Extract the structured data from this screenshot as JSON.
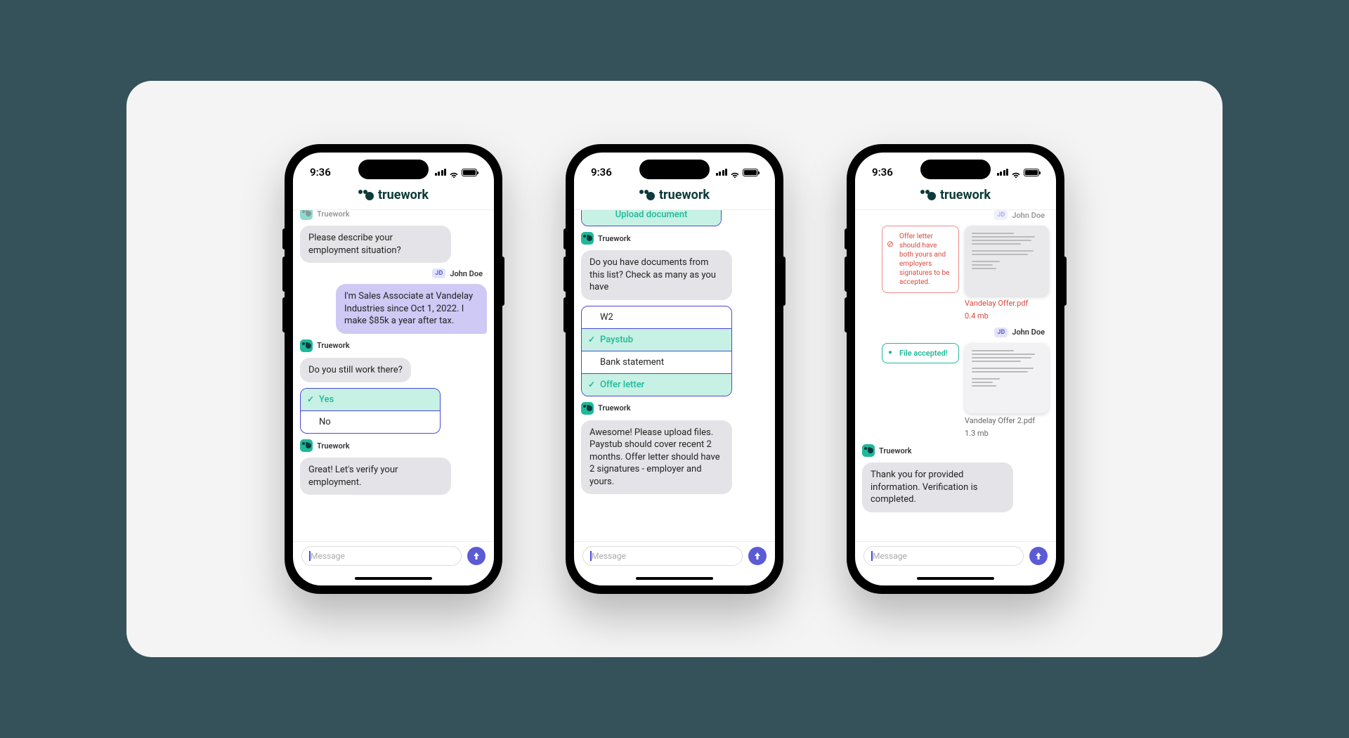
{
  "status": {
    "time": "9:36"
  },
  "brand": "truework",
  "input_placeholder": "Message",
  "phone1": {
    "tw_label": "Truework",
    "user_label": "John Doe",
    "user_initials": "JD",
    "msg1": "Please describe your employment situation?",
    "msg2": "I'm Sales Associate at Vandelay Industries since Oct 1, 2022. I make $85k a year after tax.",
    "msg3": "Do you still work there?",
    "opt_yes": "Yes",
    "opt_no": "No",
    "msg4": "Great! Let's verify your employment."
  },
  "phone2": {
    "tw_label": "Truework",
    "upload_btn": "Upload document",
    "msg1": "Do you have documents from this list? Check as many as you have",
    "opt_w2": "W2",
    "opt_paystub": "Paystub",
    "opt_bank": "Bank statement",
    "opt_offer": "Offer letter",
    "msg2": "Awesome! Please upload files. Paystub should cover recent 2 months. Offer letter should have 2 signatures - employer and yours."
  },
  "phone3": {
    "tw_label": "Truework",
    "user_label": "John Doe",
    "user_initials": "JD",
    "warn": "Offer letter should have both yours and employers signatures to be accepted.",
    "file1_name": "Vandelay Offer.pdf",
    "file1_size": "0.4 mb",
    "ok_msg": "File accepted!",
    "file2_name": "Vandelay Offer 2.pdf",
    "file2_size": "1.3 mb",
    "msg_final": "Thank you for provided information. Verification is completed."
  }
}
